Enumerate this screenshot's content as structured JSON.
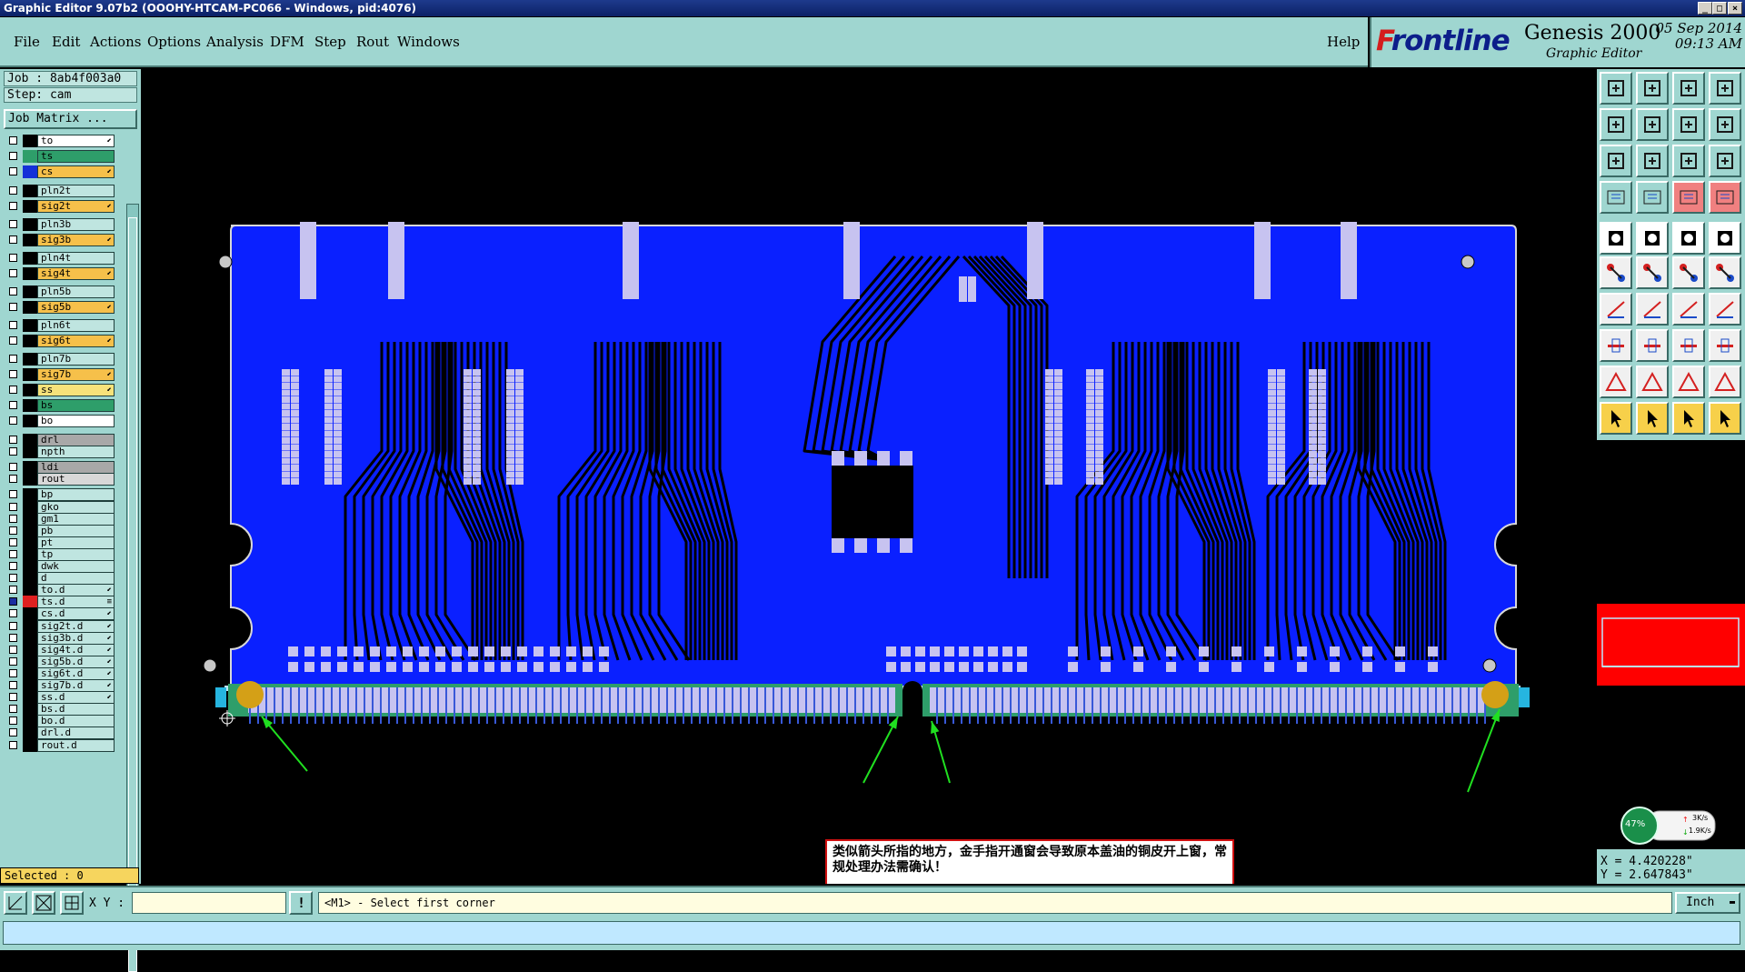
{
  "window": {
    "title": "Graphic Editor 9.07b2 (OOOHY-HTCAM-PC066 - Windows, pid:4076)",
    "controls": [
      "_",
      "□",
      "×"
    ]
  },
  "menu": {
    "items": [
      "File",
      "Edit",
      "Actions",
      "Options",
      "Analysis",
      "DFM",
      "Step",
      "Rout",
      "Windows"
    ],
    "help": "Help"
  },
  "brand": {
    "logo_prefix": "F",
    "logo_rest": "rontline",
    "product": "Genesis 2000",
    "subtitle": "Graphic Editor",
    "date": "05 Sep 2014",
    "time": "09:13 AM"
  },
  "job": {
    "job_label": "Job : 8ab4f003a0",
    "step_label": "Step: cam",
    "matrix_button": "Job Matrix ..."
  },
  "layers": [
    {
      "name": "to",
      "color": "#ffffff",
      "swatch": "#000000",
      "checked": false,
      "arrow": "⬋"
    },
    {
      "name": "ts",
      "color": "#2e9e6a",
      "swatch": "#2e9e6a",
      "checked": false,
      "arrow": ""
    },
    {
      "name": "cs",
      "color": "#f6c04a",
      "swatch": "#1530d8",
      "checked": false,
      "arrow": "⬋"
    },
    {
      "name": "pln2t",
      "color": "#bfe5e0",
      "swatch": "#000000",
      "checked": false,
      "arrow": ""
    },
    {
      "name": "sig2t",
      "color": "#f6c04a",
      "swatch": "#000000",
      "checked": false,
      "arrow": "⬋"
    },
    {
      "name": "pln3b",
      "color": "#bfe5e0",
      "swatch": "#000000",
      "checked": false,
      "arrow": ""
    },
    {
      "name": "sig3b",
      "color": "#f6c04a",
      "swatch": "#000000",
      "checked": false,
      "arrow": "⬋"
    },
    {
      "name": "pln4t",
      "color": "#bfe5e0",
      "swatch": "#000000",
      "checked": false,
      "arrow": ""
    },
    {
      "name": "sig4t",
      "color": "#f6c04a",
      "swatch": "#000000",
      "checked": false,
      "arrow": "⬋"
    },
    {
      "name": "pln5b",
      "color": "#bfe5e0",
      "swatch": "#000000",
      "checked": false,
      "arrow": ""
    },
    {
      "name": "sig5b",
      "color": "#f6c04a",
      "swatch": "#000000",
      "checked": false,
      "arrow": "⬋"
    },
    {
      "name": "pln6t",
      "color": "#bfe5e0",
      "swatch": "#000000",
      "checked": false,
      "arrow": ""
    },
    {
      "name": "sig6t",
      "color": "#f6c04a",
      "swatch": "#000000",
      "checked": false,
      "arrow": "⬋"
    },
    {
      "name": "pln7b",
      "color": "#bfe5e0",
      "swatch": "#000000",
      "checked": false,
      "arrow": ""
    },
    {
      "name": "sig7b",
      "color": "#f6c04a",
      "swatch": "#000000",
      "checked": false,
      "arrow": "⬋"
    },
    {
      "name": "ss",
      "color": "#f6e27a",
      "swatch": "#000000",
      "checked": false,
      "arrow": "⬋"
    },
    {
      "name": "bs",
      "color": "#2e9e6a",
      "swatch": "#000000",
      "checked": false,
      "arrow": ""
    },
    {
      "name": "bo",
      "color": "#ffffff",
      "swatch": "#000000",
      "checked": false,
      "arrow": ""
    },
    {
      "name": "drl",
      "color": "#a8a8a8",
      "swatch": "#000000",
      "checked": false,
      "arrow": ""
    },
    {
      "name": "npth",
      "color": "#bfe5e0",
      "swatch": "#000000",
      "checked": false,
      "arrow": ""
    },
    {
      "name": "ldi",
      "color": "#a8a8a8",
      "swatch": "#000000",
      "checked": false,
      "arrow": ""
    },
    {
      "name": "rout",
      "color": "#d8d8d8",
      "swatch": "#000000",
      "checked": false,
      "arrow": ""
    },
    {
      "name": "bp",
      "color": "#bfe5e0",
      "swatch": "#000000",
      "checked": false,
      "arrow": ""
    },
    {
      "name": "gko",
      "color": "#bfe5e0",
      "swatch": "#000000",
      "checked": false,
      "arrow": ""
    },
    {
      "name": "gm1",
      "color": "#bfe5e0",
      "swatch": "#000000",
      "checked": false,
      "arrow": ""
    },
    {
      "name": "pb",
      "color": "#bfe5e0",
      "swatch": "#000000",
      "checked": false,
      "arrow": ""
    },
    {
      "name": "pt",
      "color": "#bfe5e0",
      "swatch": "#000000",
      "checked": false,
      "arrow": ""
    },
    {
      "name": "tp",
      "color": "#bfe5e0",
      "swatch": "#000000",
      "checked": false,
      "arrow": ""
    },
    {
      "name": "dwk",
      "color": "#bfe5e0",
      "swatch": "#000000",
      "checked": false,
      "arrow": ""
    },
    {
      "name": "d",
      "color": "#bfe5e0",
      "swatch": "#000000",
      "checked": false,
      "arrow": ""
    },
    {
      "name": "to.d",
      "color": "#bfe5e0",
      "swatch": "#000000",
      "checked": false,
      "arrow": "⬋"
    },
    {
      "name": "ts.d",
      "color": "#bfe5e0",
      "swatch": "#e02020",
      "checked": true,
      "arrow": "≡"
    },
    {
      "name": "cs.d",
      "color": "#bfe5e0",
      "swatch": "#000000",
      "checked": false,
      "arrow": "⬋"
    },
    {
      "name": "sig2t.d",
      "color": "#bfe5e0",
      "swatch": "#000000",
      "checked": false,
      "arrow": "⬋"
    },
    {
      "name": "sig3b.d",
      "color": "#bfe5e0",
      "swatch": "#000000",
      "checked": false,
      "arrow": "⬋"
    },
    {
      "name": "sig4t.d",
      "color": "#bfe5e0",
      "swatch": "#000000",
      "checked": false,
      "arrow": "⬋"
    },
    {
      "name": "sig5b.d",
      "color": "#bfe5e0",
      "swatch": "#000000",
      "checked": false,
      "arrow": "⬋"
    },
    {
      "name": "sig6t.d",
      "color": "#bfe5e0",
      "swatch": "#000000",
      "checked": false,
      "arrow": "⬋"
    },
    {
      "name": "sig7b.d",
      "color": "#bfe5e0",
      "swatch": "#000000",
      "checked": false,
      "arrow": "⬋"
    },
    {
      "name": "ss.d",
      "color": "#bfe5e0",
      "swatch": "#000000",
      "checked": false,
      "arrow": "⬋"
    },
    {
      "name": "bs.d",
      "color": "#bfe5e0",
      "swatch": "#000000",
      "checked": false,
      "arrow": ""
    },
    {
      "name": "bo.d",
      "color": "#bfe5e0",
      "swatch": "#000000",
      "checked": false,
      "arrow": ""
    },
    {
      "name": "drl.d",
      "color": "#bfe5e0",
      "swatch": "#000000",
      "checked": false,
      "arrow": ""
    },
    {
      "name": "rout.d",
      "color": "#bfe5e0",
      "swatch": "#000000",
      "checked": false,
      "arrow": ""
    }
  ],
  "selected": "Selected : 0",
  "annotation": "类似箭头所指的地方，金手指开通窗会导致原本盖油的铜皮开上窗，常规处理办法需确认！",
  "network": {
    "percent": "47%",
    "up": "3K/s",
    "down": "1.9K/s"
  },
  "coords": {
    "x": "X = 4.420228\"",
    "y": "Y = 2.647843\""
  },
  "status": {
    "xy_label": "X Y :",
    "xy_value": "",
    "prompt_icon": "!",
    "prompt": "<M1> - Select first corner",
    "units": "Inch"
  },
  "colors": {
    "panel": "#9fd6d0",
    "copper": "#0a20ff",
    "pad": "#c7c3f0",
    "gold": "#d4a017",
    "annotation_border": "#d01010",
    "arrow": "#20e020"
  }
}
